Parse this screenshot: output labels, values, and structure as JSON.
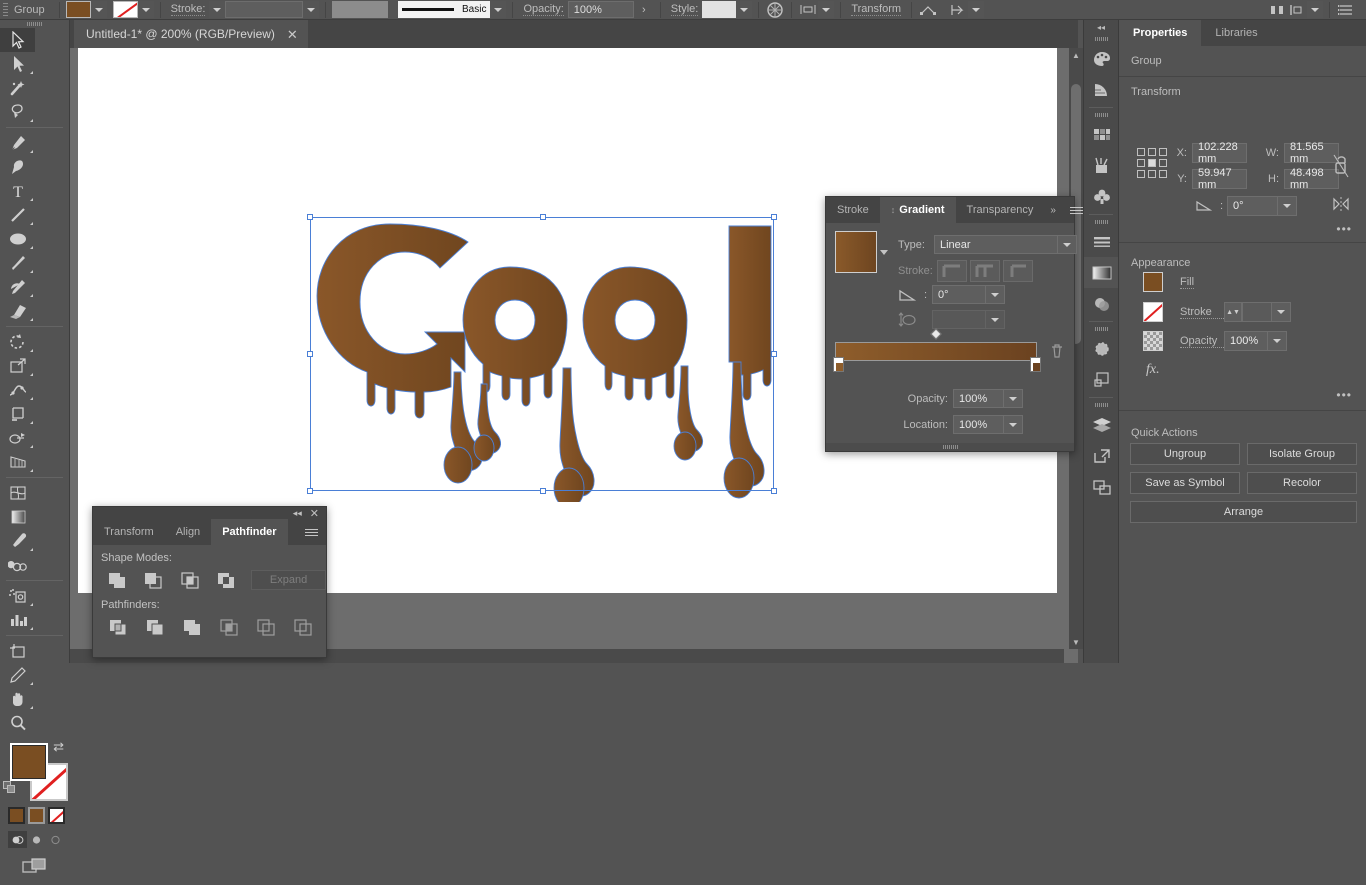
{
  "control_bar": {
    "selection_label": "Group",
    "fill_color": "#7a4e22",
    "stroke_color": "none",
    "stroke_label": "Stroke:",
    "stroke_profile": "Basic",
    "opacity_label": "Opacity:",
    "opacity_value": "100%",
    "style_label": "Style:",
    "transform_label": "Transform",
    "icons": [
      "recolor-artwork-icon",
      "align-icon",
      "anchor-point-icon",
      "arrange-icon",
      "distribute-icon",
      "align-panel-icon",
      "document-setup-icon"
    ]
  },
  "toolbar": {
    "tools": [
      {
        "name": "selection-tool",
        "glyph": "arrow",
        "selected": true,
        "corner": false
      },
      {
        "name": "direct-selection-tool",
        "glyph": "arrow-filled",
        "selected": false,
        "corner": true
      },
      {
        "name": "magic-wand-tool",
        "glyph": "wand",
        "selected": false,
        "corner": false
      },
      {
        "name": "lasso-tool",
        "glyph": "lasso",
        "selected": false,
        "corner": false
      },
      {
        "name": "pen-tool",
        "glyph": "pen",
        "selected": false,
        "corner": true
      },
      {
        "name": "curvature-tool",
        "glyph": "curvature",
        "selected": false,
        "corner": false
      },
      {
        "name": "type-tool",
        "glyph": "type",
        "selected": false,
        "corner": true
      },
      {
        "name": "line-segment-tool",
        "glyph": "line",
        "selected": false,
        "corner": true
      },
      {
        "name": "ellipse-tool",
        "glyph": "ellipse",
        "selected": false,
        "corner": true
      },
      {
        "name": "paintbrush-tool",
        "glyph": "brush",
        "selected": false,
        "corner": true
      },
      {
        "name": "shaper-tool",
        "glyph": "shaper",
        "selected": false,
        "corner": true
      },
      {
        "name": "eraser-tool",
        "glyph": "eraser",
        "selected": false,
        "corner": true
      },
      {
        "name": "rotate-tool",
        "glyph": "rotate",
        "selected": false,
        "corner": true
      },
      {
        "name": "scale-tool",
        "glyph": "scale",
        "selected": false,
        "corner": true
      },
      {
        "name": "width-tool",
        "glyph": "width",
        "selected": false,
        "corner": true
      },
      {
        "name": "free-transform-tool",
        "glyph": "freetransform",
        "selected": false,
        "corner": true
      },
      {
        "name": "shape-builder-tool",
        "glyph": "shapebuilder",
        "selected": false,
        "corner": true
      },
      {
        "name": "perspective-grid-tool",
        "glyph": "perspective",
        "selected": false,
        "corner": true
      },
      {
        "name": "mesh-tool",
        "glyph": "mesh",
        "selected": false,
        "corner": false
      },
      {
        "name": "gradient-tool",
        "glyph": "gradient",
        "selected": false,
        "corner": false
      },
      {
        "name": "eyedropper-tool",
        "glyph": "eyedropper",
        "selected": false,
        "corner": true
      },
      {
        "name": "blend-tool",
        "glyph": "blend",
        "selected": false,
        "corner": false
      },
      {
        "name": "symbol-sprayer-tool",
        "glyph": "sprayer",
        "selected": false,
        "corner": true
      },
      {
        "name": "column-graph-tool",
        "glyph": "graph",
        "selected": false,
        "corner": true
      },
      {
        "name": "artboard-tool",
        "glyph": "artboard",
        "selected": false,
        "corner": false
      },
      {
        "name": "slice-tool",
        "glyph": "slice",
        "selected": false,
        "corner": true
      },
      {
        "name": "hand-tool",
        "glyph": "hand",
        "selected": false,
        "corner": true
      },
      {
        "name": "zoom-tool",
        "glyph": "zoom",
        "selected": false,
        "corner": false
      }
    ],
    "fill_swatch": "#7a4e22",
    "stroke_swatch": "none",
    "color_modes": [
      "color-swatch",
      "gradient-swatch",
      "none-swatch"
    ],
    "draw_modes": [
      "draw-normal",
      "draw-behind",
      "draw-inside"
    ],
    "screen_mode": "change-screen-mode"
  },
  "document_tab": {
    "title": "Untitled-1* @ 200% (RGB/Preview)",
    "close_glyph": "✕"
  },
  "artwork": {
    "text": "Cool",
    "style": "melting chocolate drip lettering",
    "fill_gradient_start": "#8e5d2b",
    "fill_gradient_end": "#6b4220",
    "selection_stroke": "#4a7fd6"
  },
  "gradient_panel": {
    "tabs": [
      {
        "label": "Stroke",
        "active": false
      },
      {
        "label": "Gradient",
        "active": true
      },
      {
        "label": "Transparency",
        "active": false
      }
    ],
    "overflow_glyph": "»",
    "type_label": "Type:",
    "type_value": "Linear",
    "stroke_label": "Stroke:",
    "angle_label": "angle-icon",
    "angle_value": "0°",
    "aspect_label": "aspect-ratio-icon",
    "aspect_value": "",
    "opacity_label": "Opacity:",
    "opacity_value": "100%",
    "location_label": "Location:",
    "location_value": "100%",
    "stops": [
      {
        "position": 0,
        "color": "#8e5d2b"
      },
      {
        "position": 100,
        "color": "#6b4220"
      }
    ],
    "midpoint": 50,
    "gradient_start": "#8e5d2b",
    "gradient_end": "#6b4220",
    "delete_stop_glyph": "🗑"
  },
  "pathfinder_panel": {
    "collapse_glyph": "◂◂",
    "close_glyph": "✕",
    "tabs": [
      {
        "label": "Transform",
        "active": false
      },
      {
        "label": "Align",
        "active": false
      },
      {
        "label": "Pathfinder",
        "active": true
      }
    ],
    "shape_modes_label": "Shape Modes:",
    "shape_modes": [
      "unite",
      "minus-front",
      "intersect",
      "exclude"
    ],
    "expand_label": "Expand",
    "pathfinders_label": "Pathfinders:",
    "pathfinders": [
      "divide",
      "trim",
      "merge",
      "crop",
      "outline",
      "minus-back"
    ]
  },
  "dock": {
    "collapse_glyph": "◂◂",
    "icons": [
      {
        "name": "color-panel-icon",
        "selected": false
      },
      {
        "name": "color-guide-panel-icon",
        "selected": false
      },
      {
        "name": "swatches-panel-icon",
        "selected": false
      },
      {
        "name": "brushes-panel-icon",
        "selected": false
      },
      {
        "name": "symbols-panel-icon",
        "selected": false
      },
      {
        "name": "stroke-panel-icon",
        "selected": false
      },
      {
        "name": "gradient-panel-icon",
        "selected": true
      },
      {
        "name": "transparency-panel-icon",
        "selected": false
      },
      {
        "name": "appearance-panel-icon",
        "selected": false
      },
      {
        "name": "graphic-styles-panel-icon",
        "selected": false
      },
      {
        "name": "layers-panel-icon",
        "selected": false
      },
      {
        "name": "links-panel-icon",
        "selected": false
      },
      {
        "name": "artboards-panel-icon",
        "selected": false
      }
    ]
  },
  "properties": {
    "tabs": [
      {
        "label": "Properties",
        "active": true
      },
      {
        "label": "Libraries",
        "active": false
      }
    ],
    "selection_type": "Group",
    "transform": {
      "heading": "Transform",
      "x_label": "X:",
      "x_value": "102.228 mm",
      "y_label": "Y:",
      "y_value": "59.947 mm",
      "w_label": "W:",
      "w_value": "81.565 mm",
      "h_label": "H:",
      "h_value": "48.498 mm",
      "angle_label": "angle-icon",
      "angle_value": "0°",
      "constrain_icon": "link-broken-icon",
      "flip_horizontal_icon": "flip-horizontal-icon",
      "flip_vertical_icon": "flip-vertical-icon",
      "more_options": "•••"
    },
    "appearance": {
      "heading": "Appearance",
      "fill_label": "Fill",
      "fill_color": "#7a4e22",
      "stroke_label": "Stroke",
      "stroke_color": "none",
      "stroke_weight": "",
      "opacity_label": "Opacity",
      "opacity_value": "100%",
      "fx_label": "fx.",
      "more_options": "•••"
    },
    "quick_actions": {
      "heading": "Quick Actions",
      "buttons": [
        "Ungroup",
        "Isolate Group",
        "Save as Symbol",
        "Recolor",
        "Arrange"
      ]
    }
  }
}
